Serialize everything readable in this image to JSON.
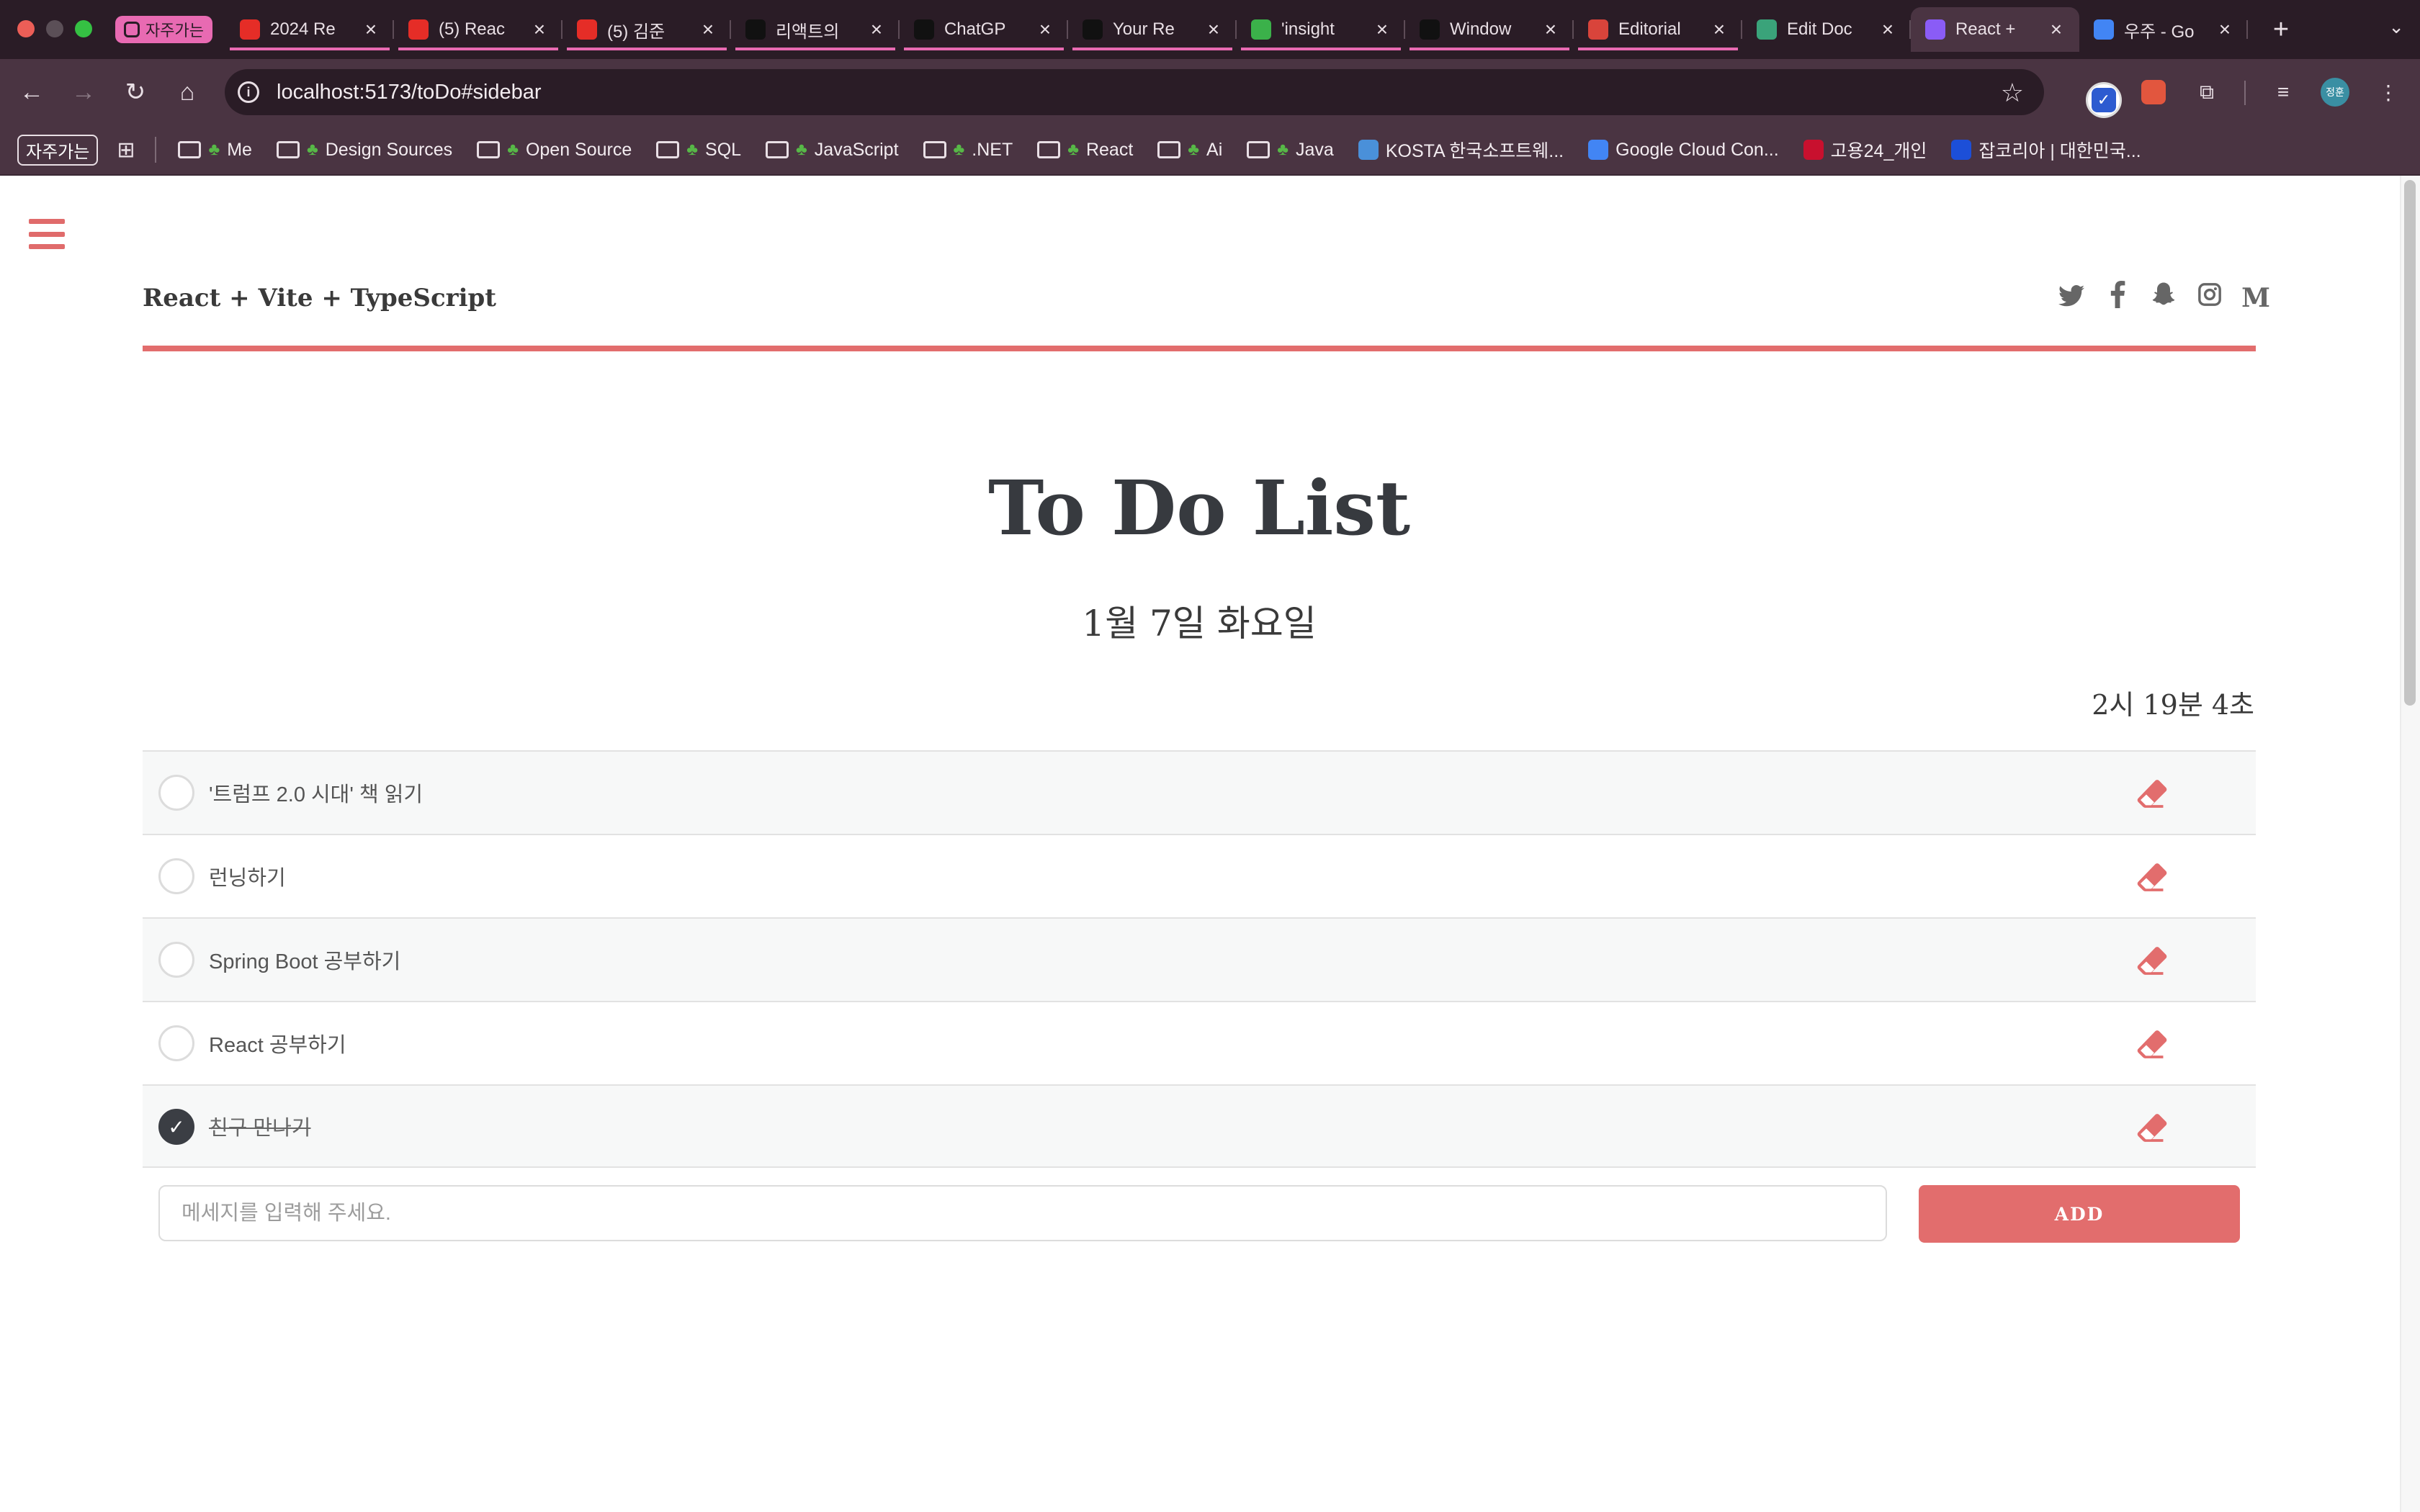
{
  "browser": {
    "tab_group_label": "자주가는",
    "tabs": [
      {
        "title": "2024 Re",
        "favicon_color": "#e52d27",
        "favicon": "yt"
      },
      {
        "title": "(5) Reac",
        "favicon_color": "#e52d27",
        "favicon": "yt"
      },
      {
        "title": "(5) 김준",
        "favicon_color": "#e52d27",
        "favicon": "yt"
      },
      {
        "title": "리액트의",
        "favicon_color": "#111111",
        "favicon": "gear"
      },
      {
        "title": "ChatGP",
        "favicon_color": "#111111",
        "favicon": "gpt"
      },
      {
        "title": "Your Re",
        "favicon_color": "#111111",
        "favicon": "gh"
      },
      {
        "title": "'insight",
        "favicon_color": "#3bb14a",
        "favicon": "ka"
      },
      {
        "title": "Window",
        "favicon_color": "#111111",
        "favicon": "M"
      },
      {
        "title": "Editorial",
        "favicon_color": "#d9443b",
        "favicon": "NSU"
      },
      {
        "title": "Edit Doc",
        "favicon_color": "#3aa37a",
        "favicon": "edit"
      },
      {
        "title": "React +",
        "favicon_color": "#8a5cf6",
        "favicon": "vite"
      },
      {
        "title": "우주 - Go",
        "favicon_color": "#4285f4",
        "favicon": "G"
      }
    ],
    "active_tab_index": 10,
    "url": "localhost:5173/toDo#sidebar",
    "bookmarks_chip": "자주가는",
    "bookmarks": [
      {
        "label": "Me",
        "type": "folder"
      },
      {
        "label": "Design Sources",
        "type": "folder-plain"
      },
      {
        "label": "Open Source",
        "type": "folder"
      },
      {
        "label": "SQL",
        "type": "folder"
      },
      {
        "label": "JavaScript",
        "type": "folder"
      },
      {
        "label": ".NET",
        "type": "folder"
      },
      {
        "label": "React",
        "type": "folder"
      },
      {
        "label": "Ai",
        "type": "folder"
      },
      {
        "label": "Java",
        "type": "folder"
      },
      {
        "label": "KOSTA 한국소프트웨...",
        "type": "site",
        "color": "#4a90d9"
      },
      {
        "label": "Google Cloud Con...",
        "type": "site",
        "color": "#4285f4"
      },
      {
        "label": "고용24_개인",
        "type": "site",
        "color": "#c8102e"
      },
      {
        "label": "잡코리아 | 대한민국...",
        "type": "site",
        "color": "#1c4fd8"
      }
    ],
    "avatar_initials": "정훈"
  },
  "page": {
    "site_title": "React + Vite + TypeScript",
    "social_icons": [
      "twitter-icon",
      "facebook-icon",
      "snapchat-icon",
      "instagram-icon",
      "medium-icon"
    ],
    "main_title": "To Do List",
    "date": "1월 7일 화요일",
    "time": "2시 19분 4초",
    "todos": [
      {
        "text": "'트럼프 2.0 시대' 책 읽기",
        "done": false
      },
      {
        "text": "런닝하기",
        "done": false
      },
      {
        "text": "Spring Boot 공부하기",
        "done": false
      },
      {
        "text": "React 공부하기",
        "done": false
      },
      {
        "text": "친구 만나기",
        "done": true
      }
    ],
    "input_placeholder": "메세지를 입력해 주세요.",
    "add_label": "ADD"
  },
  "colors": {
    "accent": "#e26d6d",
    "chrome_dark": "#2a1c26",
    "chrome": "#4a3442",
    "text_dark": "#373a3f"
  }
}
